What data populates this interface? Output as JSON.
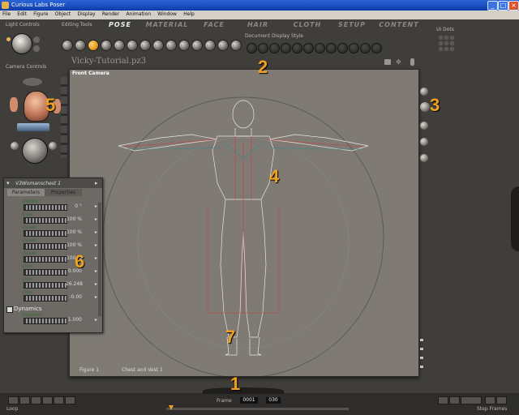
{
  "window": {
    "title": "Curious Labs Poser"
  },
  "menu": [
    "File",
    "Edit",
    "Figure",
    "Object",
    "Display",
    "Render",
    "Animation",
    "Window",
    "Help"
  ],
  "tabs": [
    {
      "label": "POSE",
      "active": true
    },
    {
      "label": "MATERIAL",
      "active": false
    },
    {
      "label": "FACE",
      "active": false
    },
    {
      "label": "HAIR",
      "active": false
    },
    {
      "label": "CLOTH",
      "active": false
    },
    {
      "label": "SETUP",
      "active": false
    },
    {
      "label": "CONTENT",
      "active": false
    }
  ],
  "labels": {
    "light_controls": "Light Controls",
    "editing_tools": "Editing Tools",
    "doc_display_style": "Document Display Style",
    "ui_dots": "UI Dots",
    "camera_controls": "Camera Controls",
    "document_title": "Vicky-Tutorial.pz3",
    "camera_name": "Front Camera",
    "figure_select": "Figure 1",
    "actor_select": "Chest and Vest 1",
    "frame_label": "Frame",
    "frame_current": "0001",
    "frame_total": "030",
    "loop": "Loop",
    "step": "Step Frames"
  },
  "params": {
    "title": "V3Womanschest 1",
    "tabs": [
      "Parameters",
      "Properties"
    ],
    "rows": [
      {
        "label": "xRotate",
        "value": "0 °"
      },
      {
        "label": "Scale",
        "value": "100 %"
      },
      {
        "label": "xScale",
        "value": "100 %"
      },
      {
        "label": "yScale",
        "value": "100 %"
      },
      {
        "label": "zScale",
        "value": "100 %"
      },
      {
        "label": "xTran",
        "value": "0.000"
      },
      {
        "label": "yTran",
        "value": "26.248"
      },
      {
        "label": "zTran",
        "value": "-0.00"
      }
    ],
    "dynamics_check": "Dynamics",
    "dynamics_row": {
      "label": "Dynamics",
      "value": "1.000"
    }
  },
  "callouts": [
    "1",
    "2",
    "3",
    "4",
    "5",
    "6",
    "7"
  ],
  "colors": {
    "accent": "#f0a020",
    "titlebar": "#0b3ea8",
    "viewport_bg": "#7f7a74"
  }
}
